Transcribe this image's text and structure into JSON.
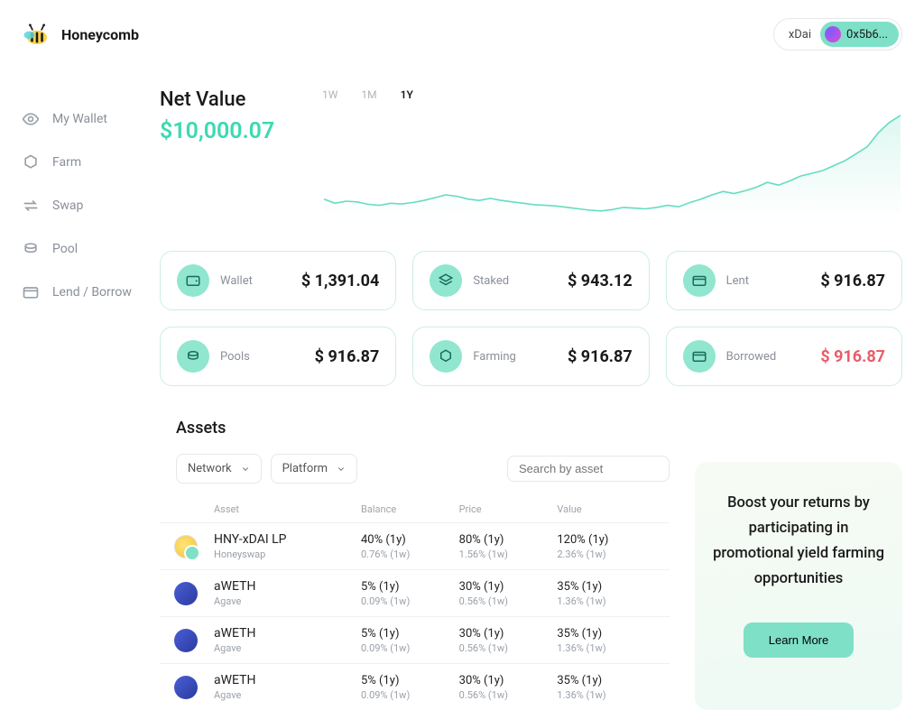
{
  "brand": "Honeycomb",
  "header": {
    "network": "xDai",
    "wallet": "0x5b6..."
  },
  "sidebar": {
    "items": [
      {
        "label": "My Wallet",
        "icon": "eye"
      },
      {
        "label": "Farm",
        "icon": "hex"
      },
      {
        "label": "Swap",
        "icon": "swap"
      },
      {
        "label": "Pool",
        "icon": "coins"
      },
      {
        "label": "Lend / Borrow",
        "icon": "card"
      }
    ]
  },
  "netvalue": {
    "label": "Net Value",
    "amount": "$10,000.07"
  },
  "periods": {
    "items": [
      "1W",
      "1M",
      "1Y"
    ],
    "active": "1Y"
  },
  "cards": [
    {
      "label": "Wallet",
      "value": "$ 1,391.04",
      "icon": "wallet"
    },
    {
      "label": "Staked",
      "value": "$ 943.12",
      "icon": "layers"
    },
    {
      "label": "Lent",
      "value": "$ 916.87",
      "icon": "card"
    },
    {
      "label": "Pools",
      "value": "$ 916.87",
      "icon": "coins"
    },
    {
      "label": "Farming",
      "value": "$ 916.87",
      "icon": "hex"
    },
    {
      "label": "Borrowed",
      "value": "$ 916.87",
      "icon": "card",
      "negative": true
    }
  ],
  "assets": {
    "title": "Assets",
    "filters": {
      "network": "Network",
      "platform": "Platform"
    },
    "search_placeholder": "Search by asset",
    "columns": [
      "Asset",
      "Balance",
      "Price",
      "Value"
    ],
    "rows": [
      {
        "name": "HNY-xDAI LP",
        "sub": "Honeyswap",
        "lp": true,
        "balance": "40% (1y)",
        "balance_sub": "0.76% (1w)",
        "price": "80% (1y)",
        "price_sub": "1.56% (1w)",
        "value": "120% (1y)",
        "value_sub": "2.36% (1w)"
      },
      {
        "name": "aWETH",
        "sub": "Agave",
        "balance": "5% (1y)",
        "balance_sub": "0.09% (1w)",
        "price": "30% (1y)",
        "price_sub": "0.56% (1w)",
        "value": "35% (1y)",
        "value_sub": "1.36% (1w)"
      },
      {
        "name": "aWETH",
        "sub": "Agave",
        "balance": "5% (1y)",
        "balance_sub": "0.09% (1w)",
        "price": "30% (1y)",
        "price_sub": "0.56% (1w)",
        "value": "35% (1y)",
        "value_sub": "1.36% (1w)"
      },
      {
        "name": "aWETH",
        "sub": "Agave",
        "balance": "5% (1y)",
        "balance_sub": "0.09% (1w)",
        "price": "30% (1y)",
        "price_sub": "0.56% (1w)",
        "value": "35% (1y)",
        "value_sub": "1.36% (1w)"
      }
    ]
  },
  "promo": {
    "text": "Boost your returns by participating in promotional yield farming opportunities",
    "cta": "Learn More"
  },
  "chart_data": {
    "type": "line",
    "title": "",
    "xlabel": "",
    "ylabel": "",
    "x_range": [
      0,
      52
    ],
    "y_range": [
      8800,
      11800
    ],
    "series": [
      {
        "name": "Net Value",
        "color": "#66dcc0",
        "values": [
          9300,
          9180,
          9240,
          9220,
          9150,
          9120,
          9180,
          9160,
          9200,
          9260,
          9340,
          9420,
          9380,
          9300,
          9260,
          9320,
          9260,
          9220,
          9180,
          9140,
          9120,
          9100,
          9060,
          9020,
          8980,
          8960,
          9000,
          9060,
          9040,
          9020,
          9060,
          9120,
          9080,
          9200,
          9300,
          9420,
          9520,
          9460,
          9540,
          9640,
          9780,
          9700,
          9820,
          9960,
          10040,
          10120,
          10260,
          10400,
          10600,
          10800,
          11200,
          11500,
          11700
        ]
      }
    ]
  }
}
